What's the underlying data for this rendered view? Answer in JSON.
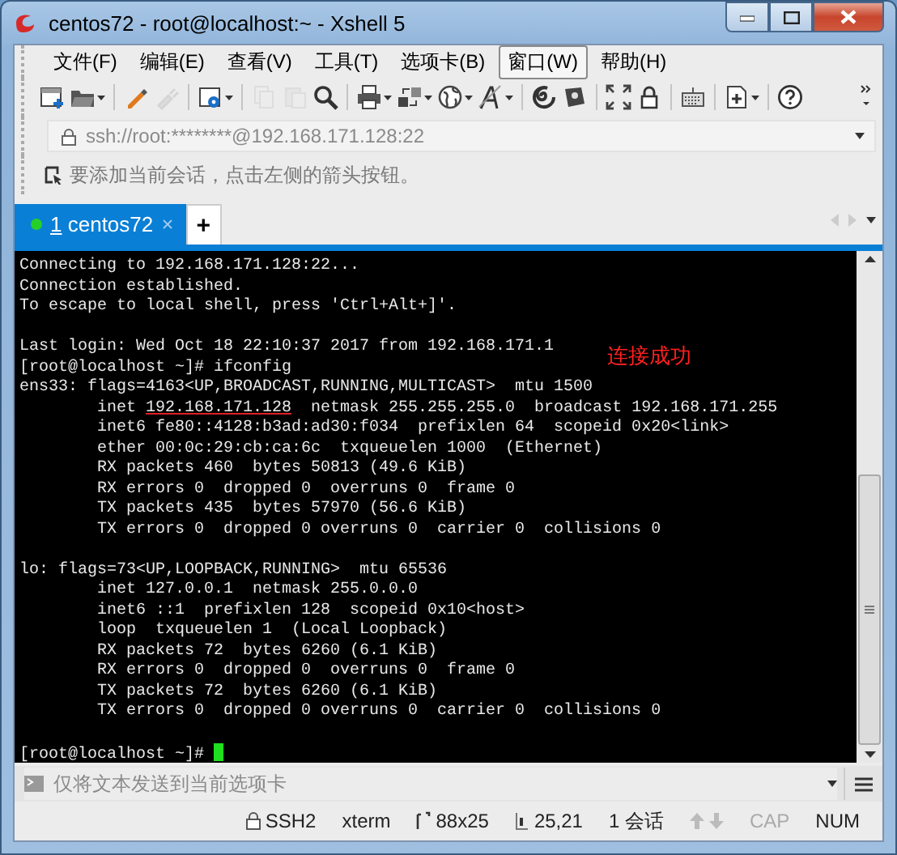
{
  "window": {
    "title": "centos72 - root@localhost:~ - Xshell 5"
  },
  "menu": [
    {
      "label": "文件(F)",
      "selected": false
    },
    {
      "label": "编辑(E)",
      "selected": false
    },
    {
      "label": "查看(V)",
      "selected": false
    },
    {
      "label": "工具(T)",
      "selected": false
    },
    {
      "label": "选项卡(B)",
      "selected": false
    },
    {
      "label": "窗口(W)",
      "selected": true
    },
    {
      "label": "帮助(H)",
      "selected": false
    }
  ],
  "toolbar": [
    {
      "kind": "new",
      "dropdown": false,
      "disabled": false
    },
    {
      "kind": "folder",
      "dropdown": true,
      "disabled": false
    },
    {
      "kind": "sep"
    },
    {
      "kind": "connect",
      "dropdown": false,
      "disabled": false
    },
    {
      "kind": "disconnect",
      "dropdown": false,
      "disabled": true
    },
    {
      "kind": "sep"
    },
    {
      "kind": "settings",
      "dropdown": true,
      "disabled": false
    },
    {
      "kind": "sep"
    },
    {
      "kind": "copy",
      "dropdown": false,
      "disabled": true
    },
    {
      "kind": "paste",
      "dropdown": false,
      "disabled": true
    },
    {
      "kind": "search",
      "dropdown": false,
      "disabled": false
    },
    {
      "kind": "sep"
    },
    {
      "kind": "print",
      "dropdown": true,
      "disabled": false
    },
    {
      "kind": "transfer",
      "dropdown": true,
      "disabled": false
    },
    {
      "kind": "globe",
      "dropdown": true,
      "disabled": false
    },
    {
      "kind": "font",
      "dropdown": true,
      "disabled": false
    },
    {
      "kind": "sep"
    },
    {
      "kind": "spiral",
      "dropdown": false,
      "disabled": false
    },
    {
      "kind": "script",
      "dropdown": false,
      "disabled": false
    },
    {
      "kind": "sep"
    },
    {
      "kind": "fullscreen",
      "dropdown": false,
      "disabled": false
    },
    {
      "kind": "lock",
      "dropdown": false,
      "disabled": false
    },
    {
      "kind": "sep"
    },
    {
      "kind": "keyboard",
      "dropdown": false,
      "disabled": false
    },
    {
      "kind": "sep"
    },
    {
      "kind": "newtab",
      "dropdown": true,
      "disabled": false
    },
    {
      "kind": "sep"
    },
    {
      "kind": "help",
      "dropdown": false,
      "disabled": false
    }
  ],
  "address": {
    "value": "ssh://root:********@192.168.171.128:22"
  },
  "hint": "要添加当前会话，点击左侧的箭头按钮。",
  "tabs": [
    {
      "number": "1",
      "label": "centos72",
      "selected": true,
      "connected": true
    }
  ],
  "new_tab": "+",
  "terminal": {
    "lines": [
      {
        "kind": "text",
        "text": "Connecting to 192.168.171.128:22..."
      },
      {
        "kind": "text",
        "text": "Connection established."
      },
      {
        "kind": "text",
        "text": "To escape to local shell, press 'Ctrl+Alt+]'."
      },
      {
        "kind": "blank"
      },
      {
        "kind": "text",
        "text": "Last login: Wed Oct 18 22:10:37 2017 from 192.168.171.1"
      },
      {
        "kind": "text",
        "text": "[root@localhost ~]# ifconfig"
      },
      {
        "kind": "text",
        "text": "ens33: flags=4163<UP,BROADCAST,RUNNING,MULTICAST>  mtu 1500"
      },
      {
        "kind": "parts",
        "parts": [
          {
            "text": "        inet ",
            "underlined": false
          },
          {
            "text": "192.168.171.128",
            "underlined": true
          },
          {
            "text": "  netmask 255.255.255.0  broadcast 192.168.171.255",
            "underlined": false
          }
        ]
      },
      {
        "kind": "text",
        "text": "        inet6 fe80::4128:b3ad:ad30:f034  prefixlen 64  scopeid 0x20<link>"
      },
      {
        "kind": "text",
        "text": "        ether 00:0c:29:cb:ca:6c  txqueuelen 1000  (Ethernet)"
      },
      {
        "kind": "text",
        "text": "        RX packets 460  bytes 50813 (49.6 KiB)"
      },
      {
        "kind": "text",
        "text": "        RX errors 0  dropped 0  overruns 0  frame 0"
      },
      {
        "kind": "text",
        "text": "        TX packets 435  bytes 57970 (56.6 KiB)"
      },
      {
        "kind": "text",
        "text": "        TX errors 0  dropped 0 overruns 0  carrier 0  collisions 0"
      },
      {
        "kind": "blank"
      },
      {
        "kind": "text",
        "text": "lo: flags=73<UP,LOOPBACK,RUNNING>  mtu 65536"
      },
      {
        "kind": "text",
        "text": "        inet 127.0.0.1  netmask 255.0.0.0"
      },
      {
        "kind": "text",
        "text": "        inet6 ::1  prefixlen 128  scopeid 0x10<host>"
      },
      {
        "kind": "text",
        "text": "        loop  txqueuelen 1  (Local Loopback)"
      },
      {
        "kind": "text",
        "text": "        RX packets 72  bytes 6260 (6.1 KiB)"
      },
      {
        "kind": "text",
        "text": "        RX errors 0  dropped 0  overruns 0  frame 0"
      },
      {
        "kind": "text",
        "text": "        TX packets 72  bytes 6260 (6.1 KiB)"
      },
      {
        "kind": "text",
        "text": "        TX errors 0  dropped 0 overruns 0  carrier 0  collisions 0"
      },
      {
        "kind": "blank"
      },
      {
        "kind": "prompt",
        "text": "[root@localhost ~]#",
        "cursor": true
      }
    ],
    "annotation": "连接成功"
  },
  "compose": {
    "placeholder": "仅将文本发送到当前选项卡"
  },
  "status_bar": [
    {
      "kind": "lock",
      "text": "SSH2",
      "on": true
    },
    {
      "kind": "plain",
      "text": "xterm",
      "on": true
    },
    {
      "kind": "size",
      "text": "88x25",
      "on": true
    },
    {
      "kind": "cursor",
      "text": "25,21",
      "on": true
    },
    {
      "kind": "plain",
      "text": "1 会话",
      "on": true
    },
    {
      "kind": "arrows",
      "on": false
    },
    {
      "kind": "plain",
      "text": "CAP",
      "on": false
    },
    {
      "kind": "plain",
      "text": "NUM",
      "on": true
    }
  ]
}
